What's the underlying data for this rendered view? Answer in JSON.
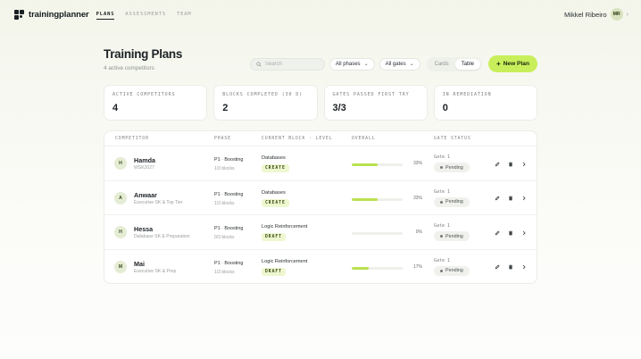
{
  "app": {
    "name": "trainingplanner"
  },
  "nav": {
    "items": [
      {
        "label": "PLANS"
      },
      {
        "label": "ASSESSMENTS"
      },
      {
        "label": "TEAM"
      }
    ]
  },
  "user": {
    "name": "Mikkel Ribeiro",
    "initials": "MR"
  },
  "header": {
    "title": "Training Plans",
    "subtitle": "4 active competitors"
  },
  "toolbar": {
    "search_placeholder": "Search",
    "phase_filter": "All phases",
    "gate_filter": "All gates",
    "view_cards": "Cards",
    "view_table": "Table",
    "new_plan": "New Plan"
  },
  "stats": [
    {
      "label": "ACTIVE COMPETITORS",
      "value": "4"
    },
    {
      "label": "BLOCKS COMPLETED (30 D)",
      "value": "2"
    },
    {
      "label": "GATES PASSED FIRST TRY",
      "value": "3/3"
    },
    {
      "label": "IN REMEDIATION",
      "value": "0"
    }
  ],
  "table": {
    "columns": [
      "COMPETITOR",
      "PHASE",
      "CURRENT BLOCK · LEVEL",
      "OVERALL",
      "GATE STATUS"
    ],
    "rows": [
      {
        "initial": "H",
        "name": "Hamda",
        "sub": "WSK2027",
        "phase": "P1 · Boosting",
        "phase_sub": "1/3 blocks",
        "block": "Databases",
        "level": "CREATE",
        "progress": 0.51,
        "pct": "33%",
        "gate": "Gate 1",
        "status": "Pending"
      },
      {
        "initial": "A",
        "name": "Anwaar",
        "sub": "Executive SK & Top Tier",
        "phase": "P1 · Boosting",
        "phase_sub": "1/3 blocks",
        "block": "Databases",
        "level": "CREATE",
        "progress": 0.51,
        "pct": "33%",
        "gate": "Gate 1",
        "status": "Pending"
      },
      {
        "initial": "H",
        "name": "Hessa",
        "sub": "Database SK & Preparation",
        "phase": "P1 · Boosting",
        "phase_sub": "0/3 blocks",
        "block": "Logic Reinforcement",
        "level": "DRAFT",
        "progress": 0.0,
        "pct": "0%",
        "gate": "Gate 1",
        "status": "Pending"
      },
      {
        "initial": "M",
        "name": "Mai",
        "sub": "Executive SK & Prep",
        "phase": "P1 · Boosting",
        "phase_sub": "1/3 blocks",
        "block": "Logic Reinforcement",
        "level": "DRAFT",
        "progress": 0.33,
        "pct": "17%",
        "gate": "Gate 1",
        "status": "Pending"
      }
    ]
  },
  "colors": {
    "accent": "#c8ef5b",
    "bar": "#b9e14f",
    "badge_bg": "#eef7cf"
  },
  "icons": {
    "row_actions": [
      "pencil-icon",
      "trash-icon",
      "chevron-right-icon"
    ]
  }
}
